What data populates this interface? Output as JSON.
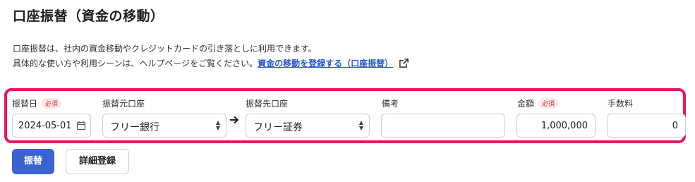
{
  "page": {
    "title": "口座振替（資金の移動）",
    "description_line1": "口座振替は、社内の資金移動やクレジットカードの引き落としに利用できます。",
    "description_line2_prefix": "具体的な使い方や利用シーンは、ヘルプページをご覧ください。",
    "help_link": "資金の移動を登録する（口座振替）",
    "external_link_icon": "external-link-icon"
  },
  "form": {
    "highlight_color": "#e8185c",
    "required_badge": "必須",
    "date": {
      "label": "振替日",
      "value": "2024-05-01",
      "icon": "calendar-icon"
    },
    "from_account": {
      "label": "振替元口座",
      "value": "フリー銀行"
    },
    "arrow_icon": "arrow-right-icon",
    "to_account": {
      "label": "振替先口座",
      "value": "フリー証券"
    },
    "memo": {
      "label": "備考",
      "value": ""
    },
    "amount": {
      "label": "金額",
      "value": "1,000,000"
    },
    "fee": {
      "label": "手数料",
      "value": "0"
    }
  },
  "actions": {
    "transfer": "振替",
    "detail_register": "詳細登録",
    "primary_color": "#3a62d1"
  }
}
